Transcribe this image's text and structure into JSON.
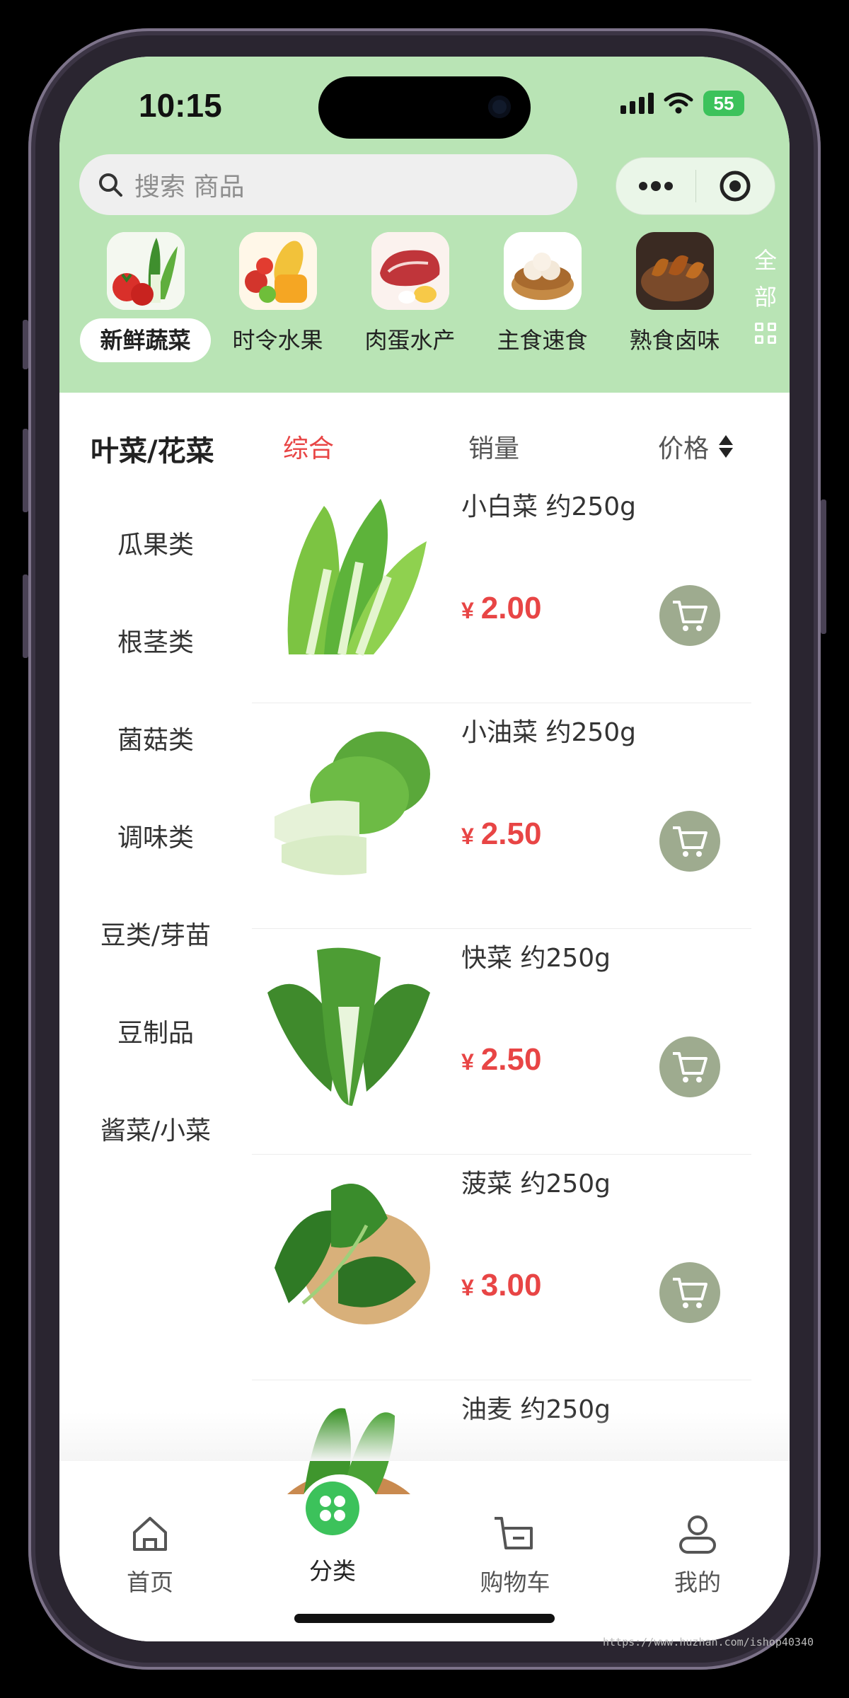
{
  "status_bar": {
    "time": "10:15",
    "battery": "55"
  },
  "search": {
    "placeholder": "搜索 商品"
  },
  "categories": [
    {
      "label": "新鲜蔬菜",
      "selected": true
    },
    {
      "label": "时令水果"
    },
    {
      "label": "肉蛋水产"
    },
    {
      "label": "主食速食"
    },
    {
      "label": "熟食卤味"
    }
  ],
  "all_button": {
    "line1": "全",
    "line2": "部"
  },
  "sidebar": {
    "title": "叶菜/花菜",
    "items": [
      "瓜果类",
      "根茎类",
      "菌菇类",
      "调味类",
      "豆类/芽苗",
      "豆制品",
      "酱菜/小菜"
    ]
  },
  "sort": {
    "comprehensive": "综合",
    "sales": "销量",
    "price": "价格"
  },
  "products": [
    {
      "name": "小白菜 约250g",
      "currency": "¥",
      "price": "2.00"
    },
    {
      "name": "小油菜 约250g",
      "currency": "¥",
      "price": "2.50"
    },
    {
      "name": "快菜 约250g",
      "currency": "¥",
      "price": "2.50"
    },
    {
      "name": "菠菜 约250g",
      "currency": "¥",
      "price": "3.00"
    },
    {
      "name": "油麦 约250g",
      "currency": "¥",
      "price": ""
    }
  ],
  "tabbar": {
    "home": "首页",
    "category": "分类",
    "cart": "购物车",
    "me": "我的"
  },
  "watermark": "https://www.huzhan.com/ishop40340",
  "colors": {
    "header_bg": "#b9e4b5",
    "accent_red": "#e84545",
    "primary_green": "#3cc25b",
    "cart_button": "#9eab8f"
  }
}
